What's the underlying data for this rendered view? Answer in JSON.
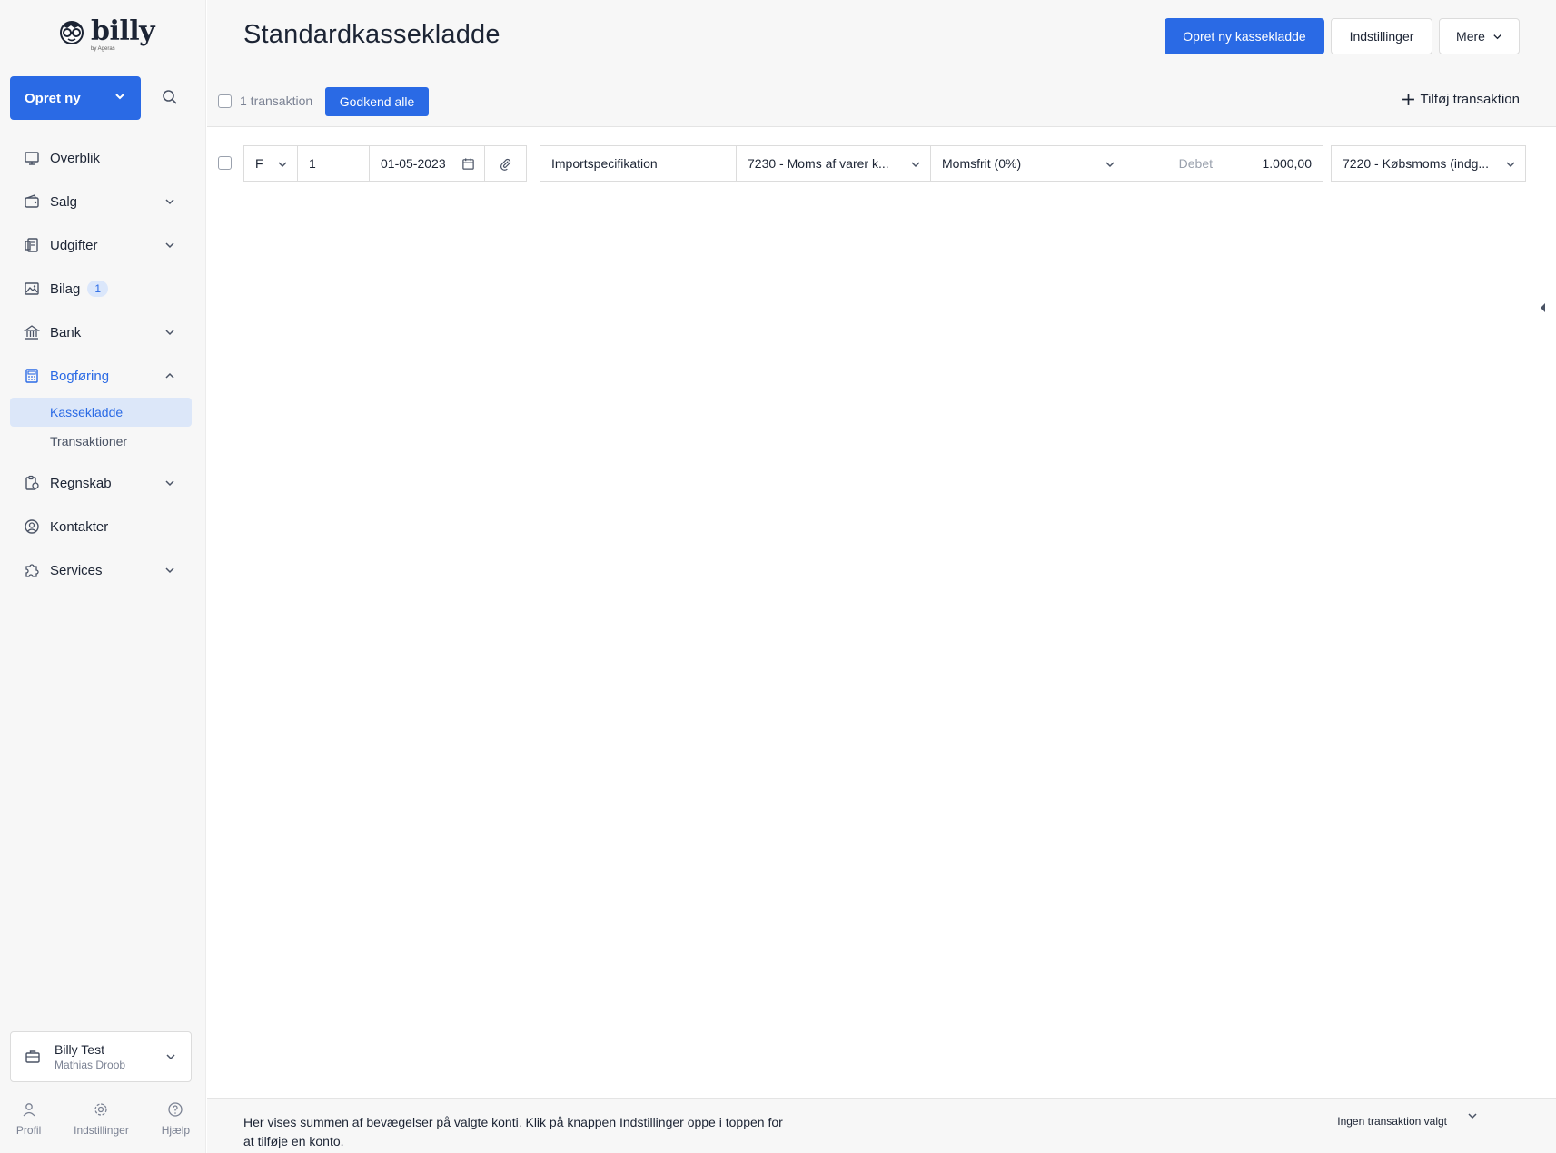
{
  "sidebar": {
    "logo": {
      "text": "billy",
      "sub": "by Ageras"
    },
    "create_button": "Opret ny",
    "nav": [
      {
        "label": "Overblik",
        "icon": "monitor-icon"
      },
      {
        "label": "Salg",
        "icon": "wallet-icon"
      },
      {
        "label": "Udgifter",
        "icon": "receipt-icon"
      },
      {
        "label": "Bilag",
        "icon": "image-icon",
        "badge": "1"
      },
      {
        "label": "Bank",
        "icon": "bank-icon"
      },
      {
        "label": "Bogføring",
        "icon": "calculator-icon"
      },
      {
        "label": "Regnskab",
        "icon": "report-icon"
      },
      {
        "label": "Kontakter",
        "icon": "contacts-icon"
      },
      {
        "label": "Services",
        "icon": "puzzle-icon"
      }
    ],
    "sub_items": [
      "Kassekladde",
      "Transaktioner"
    ],
    "company": {
      "name": "Billy Test",
      "user": "Mathias Droob"
    },
    "bottom": [
      "Profil",
      "Indstillinger",
      "Hjælp"
    ]
  },
  "header": {
    "title": "Standardkassekladde",
    "buttons": {
      "create": "Opret ny kassekladde",
      "settings": "Indstillinger",
      "more": "Mere"
    },
    "toolbar": {
      "count": "1 transaktion",
      "approve_all": "Godkend alle",
      "add_transaction": "Tilføj transaktion"
    }
  },
  "transaction": {
    "type": "F",
    "number": "1",
    "date": "01-05-2023",
    "description": "Importspecifikation",
    "account": "7230 - Moms af varer k...",
    "vat": "Momsfrit (0%)",
    "side": "Debet",
    "amount": "1.000,00",
    "contra_account": "7220 - Købsmoms (indg..."
  },
  "footer": {
    "text": "Her vises summen af bevægelser på valgte konti. Klik på knappen Indstillinger oppe i toppen for at tilføje en konto.",
    "status": "Ingen transaktion valgt"
  },
  "colors": {
    "primary": "#2a6ae5",
    "text": "#1c2434",
    "muted": "#7b8293",
    "sidebar_bg": "#f7f7f7",
    "active_bg": "#dce7f9"
  }
}
